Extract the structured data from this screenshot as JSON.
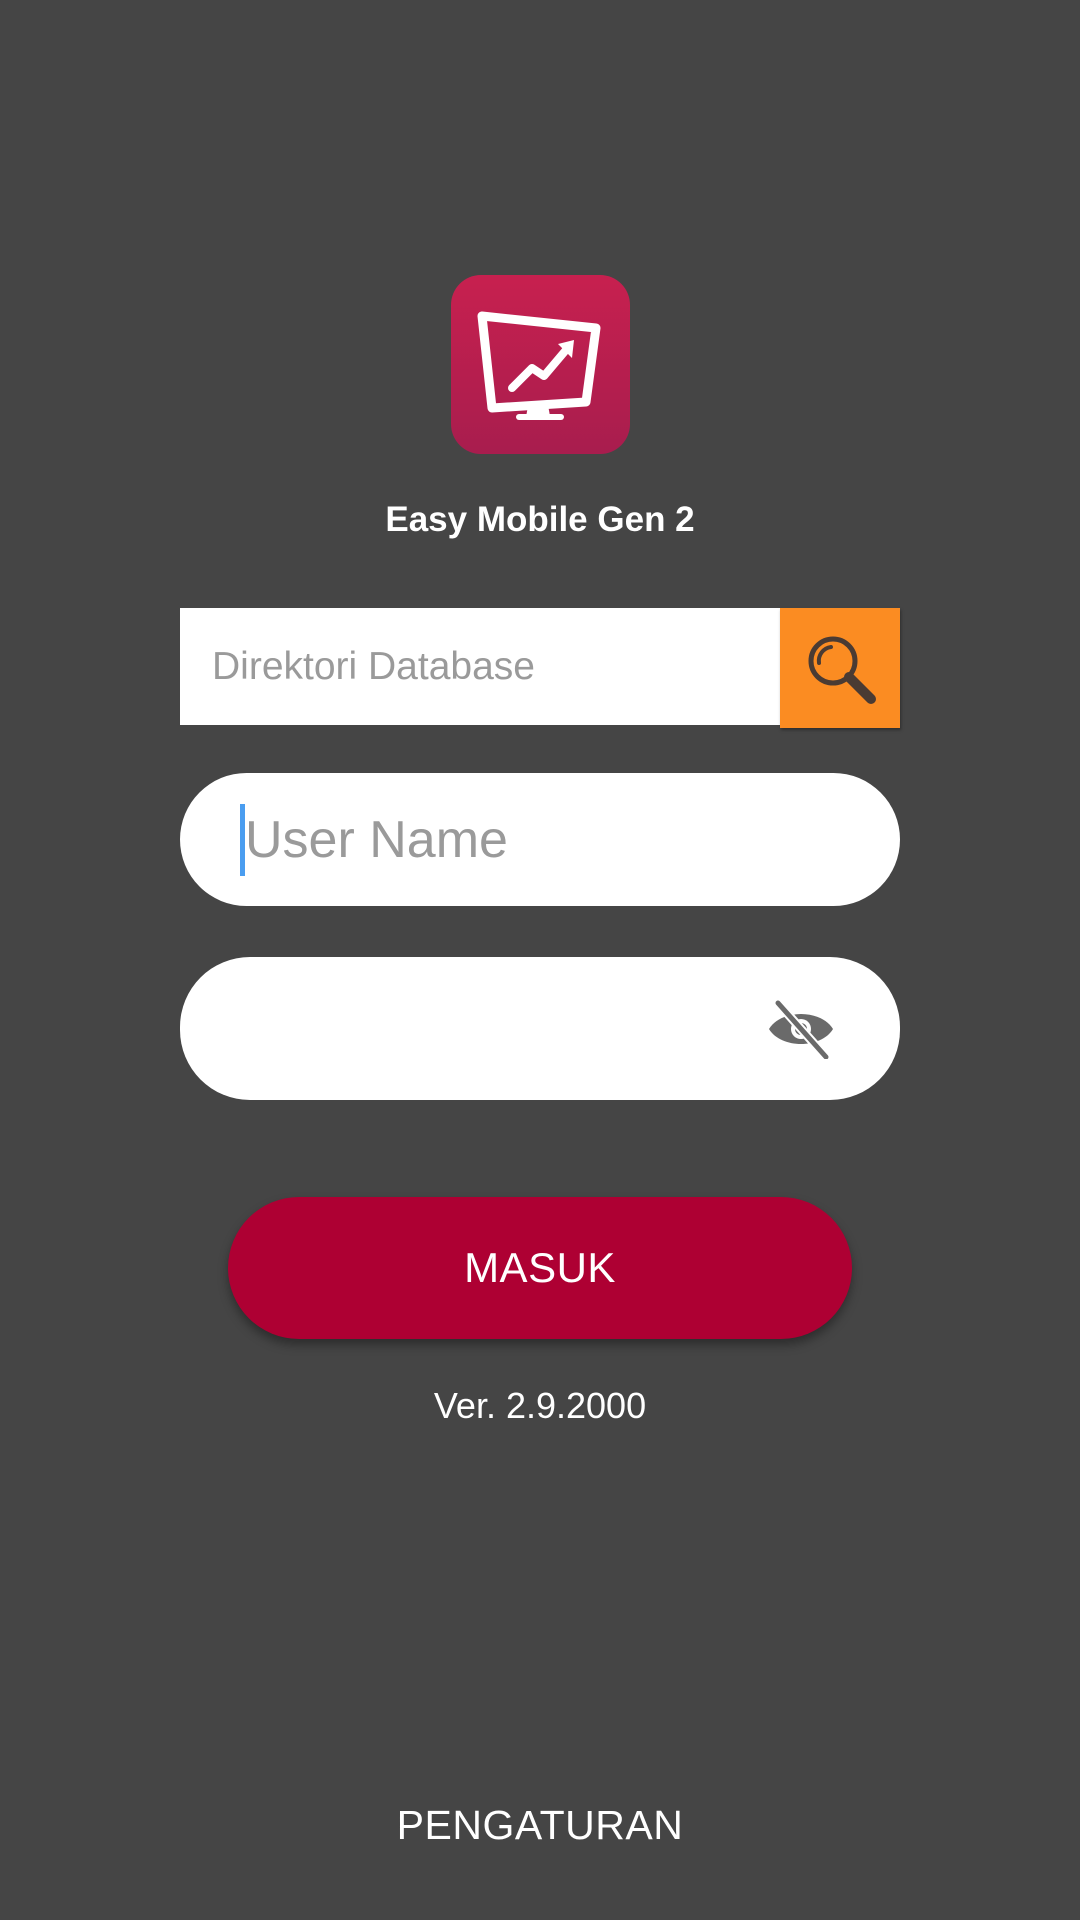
{
  "app": {
    "title": "Easy Mobile Gen 2",
    "icon": "monitor-chart-icon",
    "icon_color": "#c7204f"
  },
  "database_field": {
    "placeholder": "Direktori Database",
    "value": ""
  },
  "search_button": {
    "icon": "search-icon",
    "color": "#fb8c22"
  },
  "username_field": {
    "placeholder": "User Name",
    "value": ""
  },
  "password_field": {
    "value": "",
    "toggle_icon": "eye-off-icon"
  },
  "login_button": {
    "label": "MASUK",
    "color": "#ae0033"
  },
  "version": "Ver. 2.9.2000",
  "settings_button": {
    "label": "PENGATURAN"
  },
  "background_color": "#454545"
}
